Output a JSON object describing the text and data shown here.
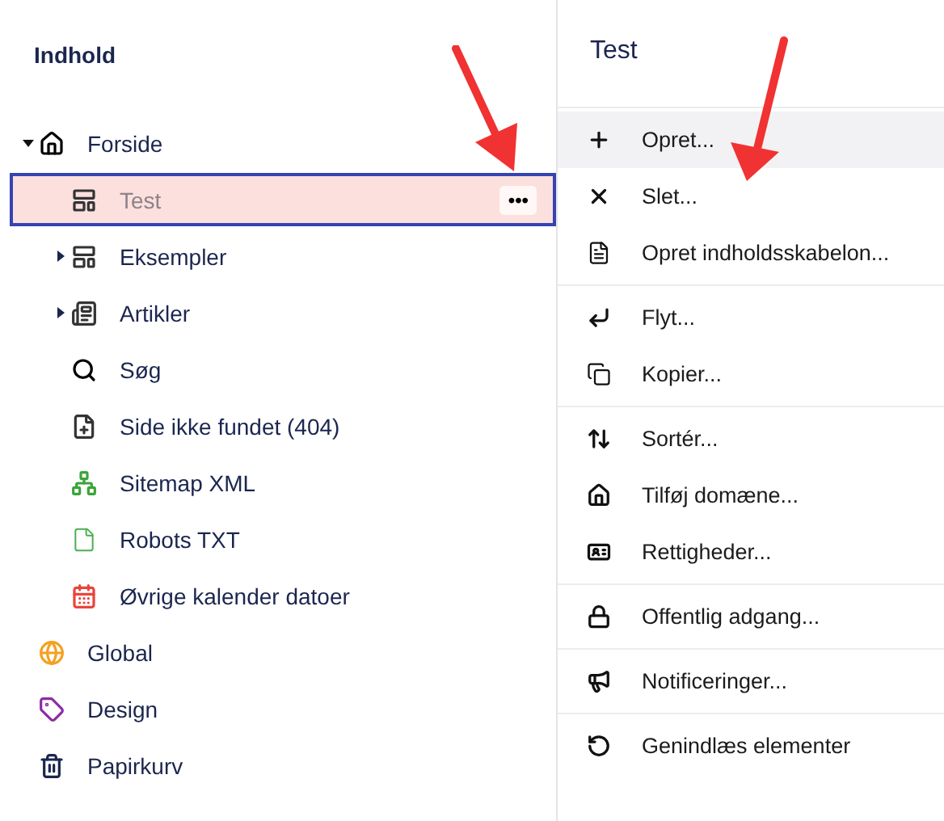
{
  "tree": {
    "title": "Indhold",
    "items": [
      {
        "label": "Forside",
        "kind": "home",
        "expanded": true,
        "selected": false,
        "children": [
          {
            "label": "Test",
            "kind": "page",
            "selected": true,
            "actions_button": "•••"
          },
          {
            "label": "Eksempler",
            "kind": "page",
            "expanded": false,
            "selected": false
          },
          {
            "label": "Artikler",
            "kind": "article",
            "expanded": false,
            "selected": false
          },
          {
            "label": "Søg",
            "kind": "search",
            "selected": false
          },
          {
            "label": "Side ikke fundet (404)",
            "kind": "page-plus",
            "selected": false
          },
          {
            "label": "Sitemap XML",
            "kind": "sitemap",
            "selected": false
          },
          {
            "label": "Robots TXT",
            "kind": "file",
            "selected": false
          },
          {
            "label": "Øvrige kalender datoer",
            "kind": "calendar",
            "selected": false
          }
        ]
      },
      {
        "label": "Global",
        "kind": "globe",
        "selected": false
      },
      {
        "label": "Design",
        "kind": "design",
        "selected": false
      },
      {
        "label": "Papirkurv",
        "kind": "trash",
        "selected": false
      }
    ]
  },
  "menu": {
    "title": "Test",
    "groups": [
      [
        {
          "label": "Opret...",
          "kind": "plus",
          "highlighted": true
        },
        {
          "label": "Slet...",
          "kind": "x",
          "highlighted": false
        },
        {
          "label": "Opret indholdsskabelon...",
          "kind": "template",
          "highlighted": false
        }
      ],
      [
        {
          "label": "Flyt...",
          "kind": "move",
          "highlighted": false
        },
        {
          "label": "Kopier...",
          "kind": "copy",
          "highlighted": false
        }
      ],
      [
        {
          "label": "Sortér...",
          "kind": "sort",
          "highlighted": false
        },
        {
          "label": "Tilføj domæne...",
          "kind": "home",
          "highlighted": false
        },
        {
          "label": "Rettigheder...",
          "kind": "permissions",
          "highlighted": false
        }
      ],
      [
        {
          "label": "Offentlig adgang...",
          "kind": "lock",
          "highlighted": false
        }
      ],
      [
        {
          "label": "Notificeringer...",
          "kind": "megaphone",
          "highlighted": false
        }
      ],
      [
        {
          "label": "Genindlæs elementer",
          "kind": "reload",
          "highlighted": false
        }
      ]
    ]
  }
}
